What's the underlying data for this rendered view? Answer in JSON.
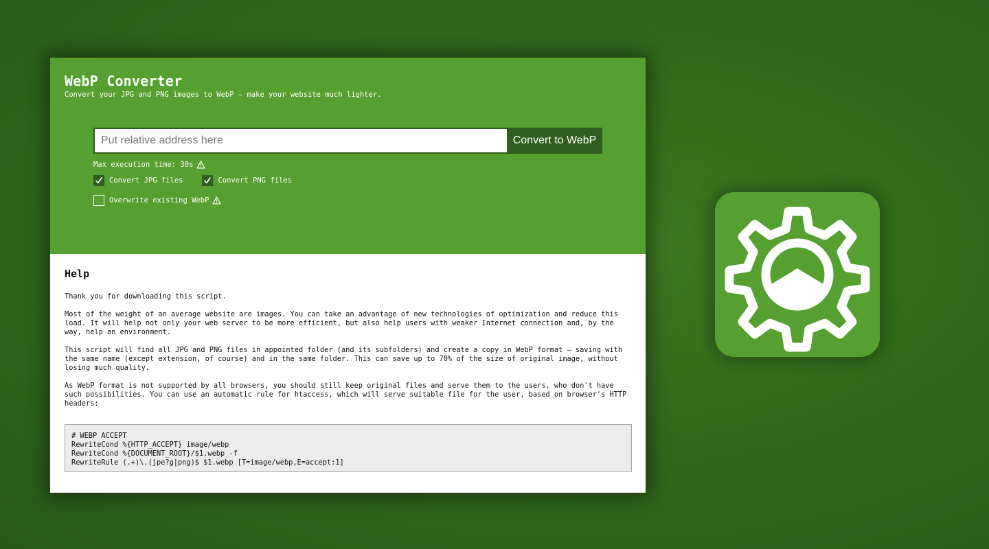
{
  "app": {
    "title": "WebP Converter",
    "subtitle": "Convert your JPG and PNG images to WebP – make your website much lighter."
  },
  "form": {
    "path_placeholder": "Put relative address here",
    "path_value": "",
    "convert_label": "Convert to WebP",
    "max_execution": "Max execution time: 30s",
    "options": {
      "jpg": {
        "label": "Convert JPG files",
        "checked": true
      },
      "png": {
        "label": "Convert PNG files",
        "checked": true
      },
      "overwrite": {
        "label": "Overwrite existing WebP",
        "checked": false
      }
    }
  },
  "help": {
    "heading": "Help",
    "paragraphs": [
      "Thank you for downloading this script.",
      "Most of the weight of an average website are images. You can take an advantage of new technologies of optimization and reduce this load. It will help not only your web server to be more efficient, but also help users with weaker Internet connection and, by the way, help an environment.",
      "This script will find all JPG and PNG files in appointed folder (and its subfolders) and create a copy in WebP format – saving with the same name (except extension, of course) and in the same folder. This can save up to 70% of the size of original image, without losing much quality.",
      "As WebP format is not supported by all browsers, you should still keep original files and serve them to the users, who don't have such possibilities. You can use an automatic rule for htaccess, which will serve suitable file for the user, based on browser's HTTP headers:"
    ],
    "code_lines": [
      "# WEBP ACCEPT",
      "RewriteCond %{HTTP_ACCEPT} image/webp",
      "RewriteCond %{DOCUMENT_ROOT}/$1.webp -f",
      "RewriteRule (.+)\\.(jpe?g|png)$ $1.webp [T=image/webp,E=accept:1]"
    ]
  },
  "icons": {
    "warning": "warning-triangle-icon",
    "check": "checkmark-icon",
    "app": "gear-mountain-icon"
  },
  "colors": {
    "background": "#316a1c",
    "header_green": "#55a030",
    "button_dark_green": "#2f5e1e",
    "code_background": "#ececec"
  }
}
